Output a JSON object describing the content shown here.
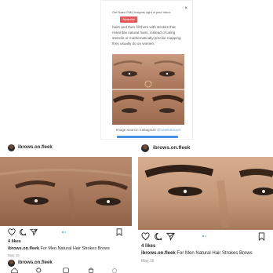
{
  "article": {
    "popup": {
      "text": "Get Naeo PMU insights right in your inbox",
      "button_label": "Subscribe",
      "close": "×"
    },
    "body_lines": [
      "hairs and then fill them with strokes that",
      "resemble natural hairs, instead of using",
      "stencils or mathematically precise mapping",
      "they usually do on women."
    ],
    "caption_prefix": "Image source: Instagram",
    "caption_link": "@nataliebrows"
  },
  "posts": [
    {
      "username": "ibrows.on.fleek",
      "likes": "4 likes",
      "caption_user": "ibrows.on.fleek",
      "caption_text": " For Men Natural Hair Strokes Brows",
      "date": "May 16"
    },
    {
      "username": "ibrows.on.fleek",
      "likes": "4 likes",
      "caption_user": "ibrows.on.fleek",
      "caption_text": " For Men Natural Hair Strokes Brows",
      "date": "May 16"
    }
  ],
  "next_post": {
    "username": "ibrows.on.fleek"
  },
  "icons": [
    "heart-icon",
    "comment-icon",
    "share-icon",
    "bookmark-icon",
    "more-icon",
    "home-icon",
    "search-icon",
    "add-icon",
    "shop-icon",
    "profile-icon"
  ],
  "colors": {
    "accent": "#3897f0",
    "subscribe": "#e55a5a",
    "progress": "#4a90e2"
  }
}
